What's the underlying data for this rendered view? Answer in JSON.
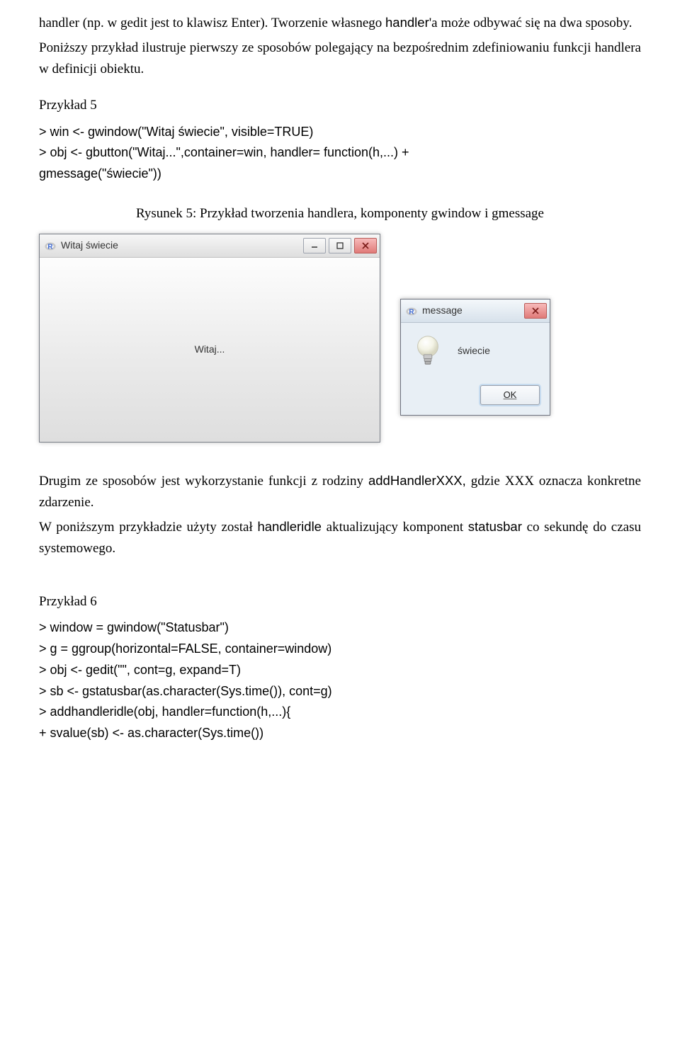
{
  "intro": {
    "p1a": "handler (np. w gedit jest to klawisz Enter). Tworzenie własnego ",
    "p1b": "'a może odbywać się na dwa sposoby.",
    "p1code": "handler",
    "p2": "Poniższy przykład ilustruje pierwszy ze sposobów polegający na bezpośrednim zdefiniowaniu funkcji handlera w definicji obiektu."
  },
  "example5": {
    "label": "Przykład 5",
    "l1": ">  win <- gwindow(\"Witaj świecie\", visible=TRUE)",
    "l2": ">  obj <- gbutton(\"Witaj...\",container=win, handler= function(h,...)  +",
    "l3": "gmessage(\"świecie\"))"
  },
  "figure": {
    "caption": "Rysunek 5: Przykład tworzenia handlera, komponenty gwindow i gmessage",
    "window_title": "Witaj świecie",
    "button_label": "Witaj...",
    "dialog_title": "message",
    "dialog_message": "świecie",
    "ok_label": "OK"
  },
  "middle": {
    "p1a": "Drugim ze sposobów jest wykorzystanie funkcji z rodziny ",
    "p1code": "addHandlerXXX,",
    "p1b": " gdzie XXX oznacza konkretne zdarzenie.",
    "p2a": "W poniższym przykładzie użyty został ",
    "p2code1": "handleridle",
    "p2b": " aktualizujący komponent ",
    "p2code2": "statusbar",
    "p2c": " co sekundę do czasu systemowego."
  },
  "example6": {
    "label": "Przykład 6",
    "l1": ">  window = gwindow(\"Statusbar\")",
    "l2": ">  g = ggroup(horizontal=FALSE, container=window)",
    "l3": ">  obj <- gedit(\"\", cont=g, expand=T)",
    "l4": ">  sb <- gstatusbar(as.character(Sys.time()), cont=g)",
    "l5": ">  addhandleridle(obj, handler=function(h,...){",
    "l6": "+  svalue(sb) <- as.character(Sys.time())"
  }
}
